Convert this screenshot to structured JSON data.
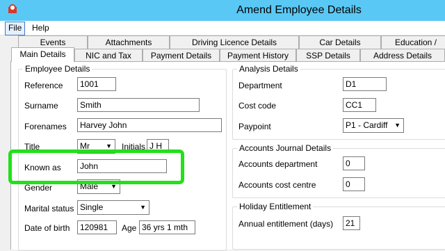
{
  "window": {
    "title": "Amend Employee Details"
  },
  "menu": {
    "file": "File",
    "help": "Help"
  },
  "tabs_row1": [
    "Events",
    "Attachments",
    "Driving Licence Details",
    "Car Details",
    "Education /"
  ],
  "tabs_row2": [
    "Main Details",
    "NIC and Tax",
    "Payment Details",
    "Payment History",
    "SSP Details",
    "Address Details"
  ],
  "employee": {
    "legend": "Employee Details",
    "reference_label": "Reference",
    "reference": "1001",
    "surname_label": "Surname",
    "surname": "Smith",
    "forenames_label": "Forenames",
    "forenames": "Harvey John",
    "title_label": "Title",
    "title": "Mr",
    "initials_label": "Initials",
    "initials": "J H",
    "known_as_label": "Known as",
    "known_as": "John",
    "gender_label": "Gender",
    "gender": "Male",
    "marital_label": "Marital status",
    "marital": "Single",
    "dob_label": "Date of birth",
    "dob": "120981",
    "age_label": "Age",
    "age": "36 yrs 1 mth"
  },
  "analysis": {
    "legend": "Analysis Details",
    "department_label": "Department",
    "department": "D1",
    "cost_code_label": "Cost code",
    "cost_code": "CC1",
    "paypoint_label": "Paypoint",
    "paypoint": "P1 - Cardiff"
  },
  "journal": {
    "legend": "Accounts Journal Details",
    "dept_label": "Accounts department",
    "dept": "0",
    "cost_centre_label": "Accounts cost centre",
    "cost_centre": "0"
  },
  "holiday": {
    "legend": "Holiday Entitlement",
    "annual_label": "Annual entitlement (days)",
    "annual": "21"
  },
  "colors": {
    "titlebar": "#5ac8f5",
    "highlight": "#22e01a"
  }
}
